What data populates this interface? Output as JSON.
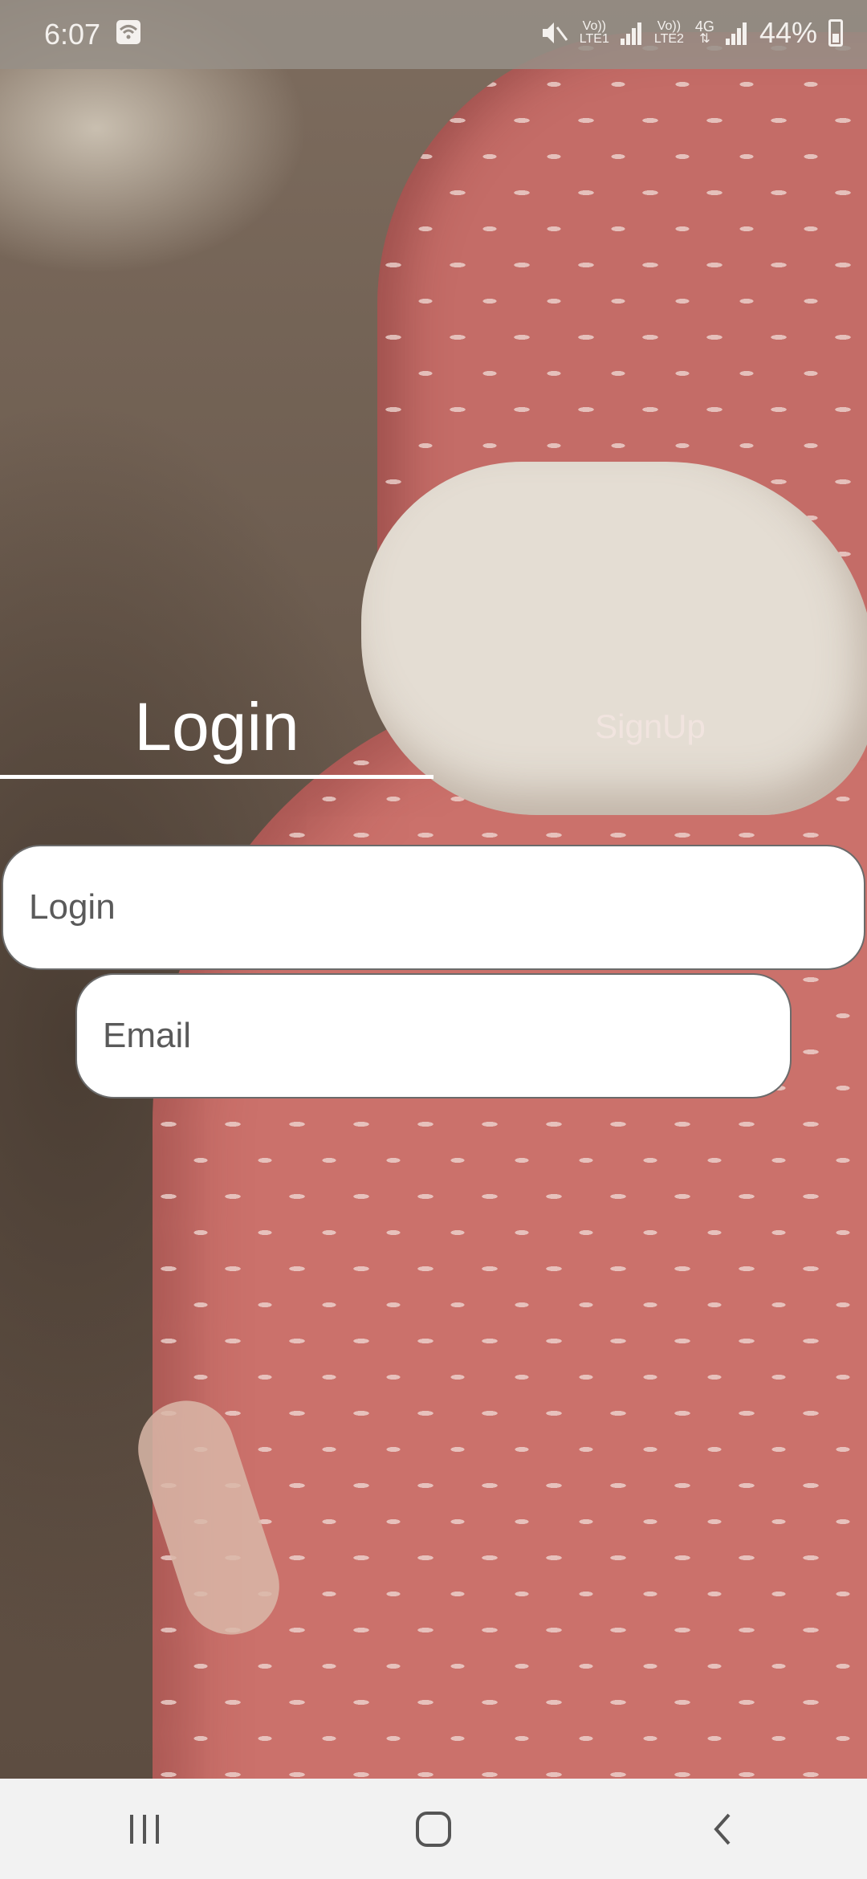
{
  "status_bar": {
    "time": "6:07",
    "sim1_label_top": "Vo))",
    "sim1_label_bottom": "LTE1",
    "sim2_label_top": "Vo))",
    "sim2_label_bottom": "LTE2",
    "network": "4G",
    "battery_percent": "44%",
    "icons": [
      "wifi-icon",
      "mute-icon",
      "signal-icon",
      "battery-charging-icon"
    ]
  },
  "tabs": {
    "login_label": "Login",
    "signup_label": "SignUp",
    "active": "Login"
  },
  "form": {
    "login_placeholder": "Login",
    "email_placeholder": "Email"
  },
  "nav_bar": {
    "icons": [
      "recent-apps-icon",
      "home-icon",
      "back-icon"
    ]
  },
  "colors": {
    "accent_text": "#ffffff",
    "dress": "#cb716b",
    "field_border": "#6b6b6b"
  }
}
